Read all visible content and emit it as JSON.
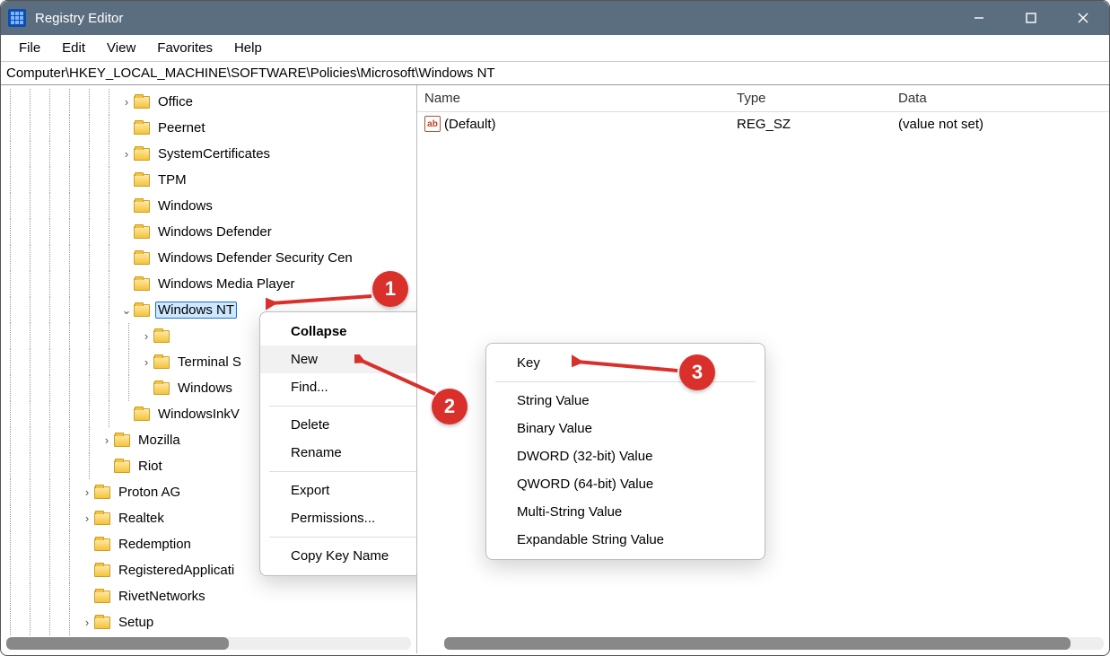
{
  "app": {
    "title": "Registry Editor"
  },
  "menubar": [
    "File",
    "Edit",
    "View",
    "Favorites",
    "Help"
  ],
  "address": "Computer\\HKEY_LOCAL_MACHINE\\SOFTWARE\\Policies\\Microsoft\\Windows NT",
  "tree": {
    "nodes": [
      {
        "depth": 6,
        "expandable": true,
        "label": "Office"
      },
      {
        "depth": 6,
        "expandable": false,
        "label": "Peernet"
      },
      {
        "depth": 6,
        "expandable": true,
        "label": "SystemCertificates"
      },
      {
        "depth": 6,
        "expandable": false,
        "label": "TPM"
      },
      {
        "depth": 6,
        "expandable": false,
        "label": "Windows"
      },
      {
        "depth": 6,
        "expandable": false,
        "label": "Windows Defender"
      },
      {
        "depth": 6,
        "expandable": false,
        "label": "Windows Defender Security Cen"
      },
      {
        "depth": 6,
        "expandable": false,
        "label": "Windows Media Player"
      },
      {
        "depth": 6,
        "expandable": true,
        "expanded": true,
        "selected": true,
        "label": "Windows NT"
      },
      {
        "depth": 7,
        "expandable": true,
        "label": ""
      },
      {
        "depth": 7,
        "expandable": true,
        "label": "Terminal S"
      },
      {
        "depth": 7,
        "expandable": false,
        "label": "Windows"
      },
      {
        "depth": 6,
        "expandable": false,
        "label": "WindowsInkV"
      },
      {
        "depth": 5,
        "expandable": true,
        "label": "Mozilla"
      },
      {
        "depth": 5,
        "expandable": false,
        "label": "Riot"
      },
      {
        "depth": 4,
        "expandable": true,
        "label": "Proton AG"
      },
      {
        "depth": 4,
        "expandable": true,
        "label": "Realtek"
      },
      {
        "depth": 4,
        "expandable": false,
        "label": "Redemption"
      },
      {
        "depth": 4,
        "expandable": false,
        "label": "RegisteredApplicati"
      },
      {
        "depth": 4,
        "expandable": false,
        "label": "RivetNetworks"
      },
      {
        "depth": 4,
        "expandable": true,
        "label": "Setup"
      }
    ]
  },
  "list": {
    "headers": {
      "name": "Name",
      "type": "Type",
      "data": "Data"
    },
    "rows": [
      {
        "name": "(Default)",
        "type": "REG_SZ",
        "data": "(value not set)"
      }
    ]
  },
  "ctxmenu1": {
    "items": [
      {
        "label": "Collapse",
        "bold": true
      },
      {
        "label": "New",
        "submenu": true,
        "hover": true
      },
      {
        "label": "Find..."
      },
      {
        "sep": true
      },
      {
        "label": "Delete"
      },
      {
        "label": "Rename"
      },
      {
        "sep": true
      },
      {
        "label": "Export"
      },
      {
        "label": "Permissions..."
      },
      {
        "sep": true
      },
      {
        "label": "Copy Key Name"
      }
    ]
  },
  "ctxmenu2": {
    "items": [
      {
        "label": "Key"
      },
      {
        "sep": true
      },
      {
        "label": "String Value"
      },
      {
        "label": "Binary Value"
      },
      {
        "label": "DWORD (32-bit) Value"
      },
      {
        "label": "QWORD (64-bit) Value"
      },
      {
        "label": "Multi-String Value"
      },
      {
        "label": "Expandable String Value"
      }
    ]
  },
  "annotations": {
    "b1": "1",
    "b2": "2",
    "b3": "3"
  }
}
